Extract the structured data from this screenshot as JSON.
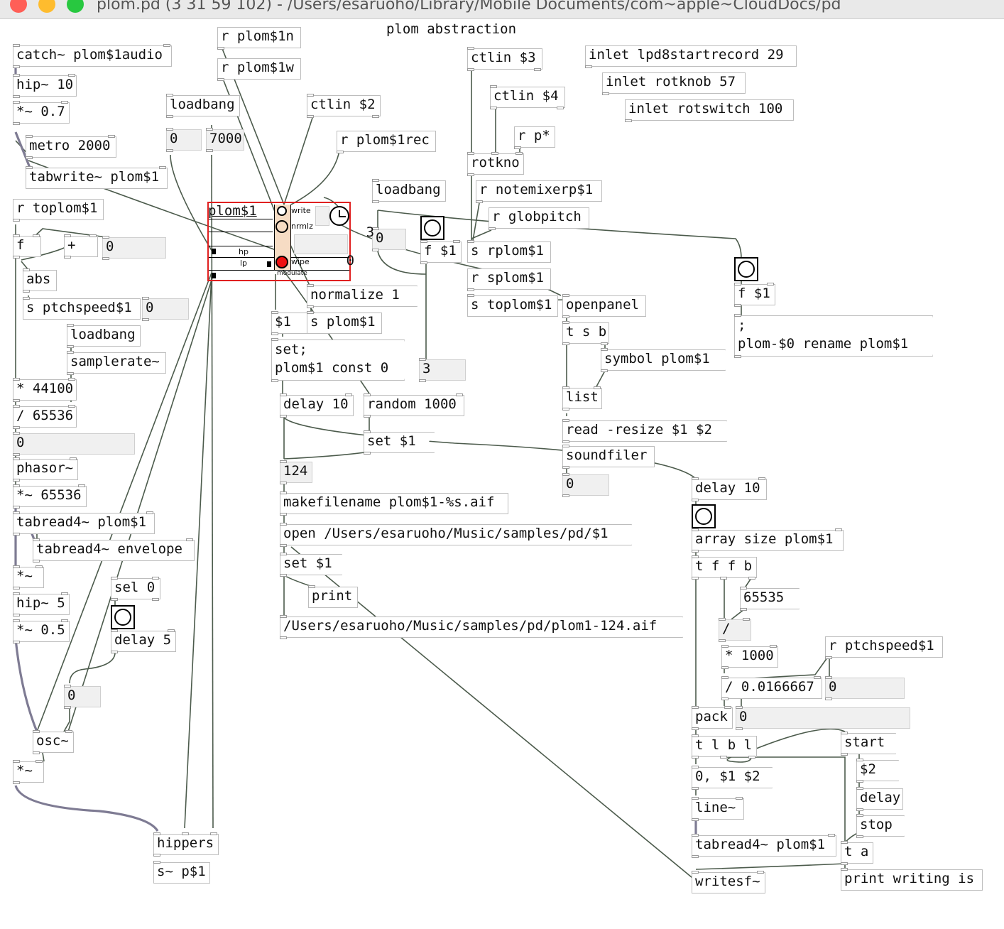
{
  "window": {
    "title": "plom.pd  (3 31 59 102) - /Users/esaruoho/Library/Mobile Documents/com~apple~CloudDocs/pd",
    "traffic_lights": {
      "close": "#ff5f57",
      "minimize": "#febc2e",
      "zoom": "#28c840"
    }
  },
  "canvas": {
    "comment": "plom abstraction",
    "objects": {
      "catch": "catch~ plom$1audio",
      "hip10": "hip~ 10",
      "mul07": "*~ 0.7",
      "metro": "metro 2000",
      "tabwrite": "tabwrite~ plom$1",
      "r_toplom": "r toplom$1",
      "f": "f",
      "plus": "+",
      "num_a": "0",
      "abs": "abs",
      "s_ptchspeed": "s ptchspeed$1",
      "num_b": "0",
      "loadbang_l": "loadbang",
      "samplerate": "samplerate~",
      "mul44100": "* 44100",
      "div65536": "/ 65536",
      "num_c": "0",
      "phasor": "phasor~",
      "mul65536": "*~ 65536",
      "tabread4_plom": "tabread4~ plom$1",
      "tabread4_env": "tabread4~ envelope",
      "mul_sig_a": "*~",
      "hip5": "hip~ 5",
      "mul05": "*~ 0.5",
      "sel0": "sel 0",
      "delay5": "delay 5",
      "num_d": "0",
      "osc": "osc~",
      "mul_sig_b": "*~",
      "hippers": "hippers",
      "s_sig": "s~ p$1",
      "r_plom1n": "r plom$1n",
      "r_plom1w": "r plom$1w",
      "loadbang_m": "loadbang",
      "num_e": "0",
      "num_7000": "7000",
      "ctlin2": "ctlin $2",
      "r_plom1rec": "r plom$1rec",
      "gop_title": "plom$1",
      "gop_write": "write",
      "gop_nrmlz": "nrmlz",
      "gop_hp": "hp",
      "gop_lp": "lp",
      "gop_wipe": "wipe",
      "gop_modulate": "modulate",
      "gop_num": "0",
      "num_3a": "3",
      "normalize": "normalize 1",
      "dollar1": "$1",
      "s_plom1": "s plom$1",
      "set_const_1": "set;",
      "set_const_2": "plom$1 const 0",
      "num_3b": "3",
      "delay10_a": "delay 10",
      "random": "random 1000",
      "set1_a": "set $1",
      "num_124": "124",
      "makefilename": "makefilename plom$1-%s.aif",
      "open": "open /Users/esaruoho/Music/samples/pd/$1",
      "set1_b": "set $1",
      "print": "print",
      "path": "/Users/esaruoho/Music/samples/pd/plom1-124.aif",
      "loadbang_r": "loadbang",
      "num_f": "0",
      "f_dollar_a": "f $1",
      "ctlin3": "ctlin $3",
      "ctlin4": "ctlin $4",
      "r_p": "r p*",
      "rotkno": "rotkno",
      "r_notemixer": "r notemixerp$1",
      "r_globpitch": "r globpitch",
      "s_rplom": "s rplom$1",
      "r_splom": "r splom$1",
      "s_toplom": "s toplom$1",
      "openpanel": "openpanel",
      "tsb": "t s b",
      "symbol_plom": "symbol plom$1",
      "list": "list",
      "read": "read -resize $1 $2",
      "soundfiler": "soundfiler",
      "num_g": "0",
      "inlet1": "inlet lpd8startrecord 29",
      "inlet2": "inlet rotknob 57",
      "inlet3": "inlet rotswitch 100",
      "f_dollar_b": "f $1",
      "rename_1": ";",
      "rename_2": "plom-$0 rename plom$1",
      "delay10_b": "delay 10",
      "array_size": "array size plom$1",
      "tffb": "t f f b",
      "num_65535": "65535",
      "div": "/",
      "mul1000": "* 1000",
      "div0166": "/ 0.0166667",
      "r_ptchspeed": "r ptchspeed$1",
      "num_h": "0",
      "pack": "pack",
      "num_i": "0",
      "tlbl": "t l b l",
      "start": "start",
      "dollar2": "$2",
      "zero_line": "0, $1 $2",
      "delay_msg": "delay",
      "line": "line~",
      "stop": "stop",
      "tabread4_b": "tabread4~ plom$1",
      "ta": "t a",
      "writesf": "writesf~",
      "print_writing": "print writing is"
    }
  }
}
